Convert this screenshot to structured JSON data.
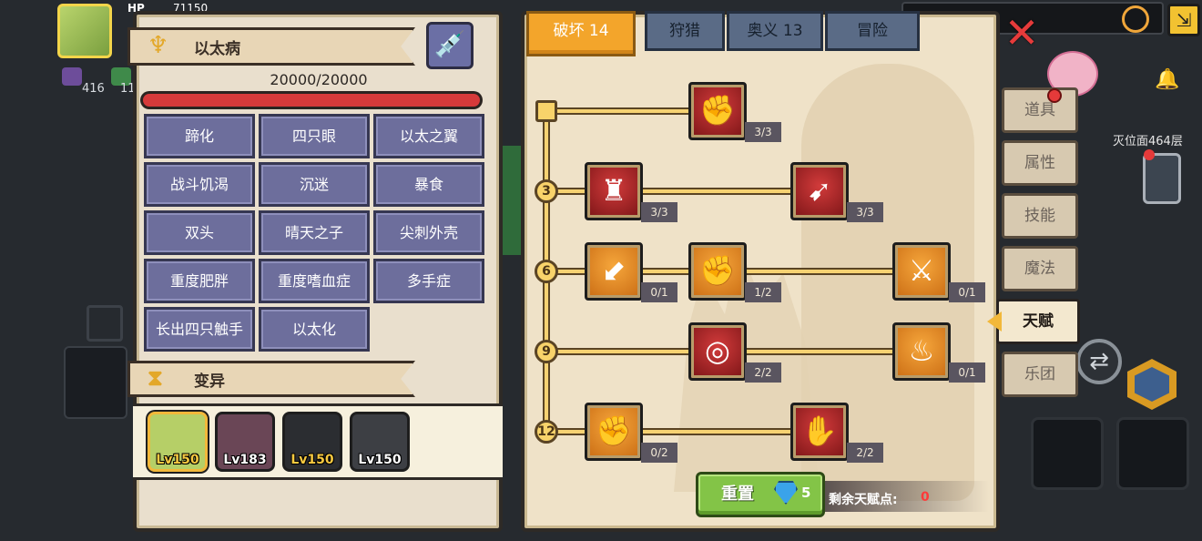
{
  "hud": {
    "hp_label": "HP",
    "hp_value": "71150",
    "stat_a": "416",
    "stat_b": "11",
    "floor_text": "灭位面464层"
  },
  "disease_panel": {
    "title": "以太病",
    "hp_text": "20000/20000",
    "hp_fraction": 1.0,
    "diseases": [
      "蹄化",
      "四只眼",
      "以太之翼",
      "战斗饥渴",
      "沉迷",
      "暴食",
      "双头",
      "晴天之子",
      "尖刺外壳",
      "重度肥胖",
      "重度嗜血症",
      "多手症",
      "长出四只触手",
      "以太化"
    ],
    "mutation_title": "变异",
    "pets": [
      {
        "level": "Lv150",
        "selected": true,
        "gold": true
      },
      {
        "level": "Lv183",
        "selected": false,
        "gold": false
      },
      {
        "level": "Lv150",
        "selected": false,
        "gold": true
      },
      {
        "level": "Lv150",
        "selected": false,
        "gold": false
      }
    ]
  },
  "talent_panel": {
    "tabs": [
      "破坏 14",
      "狩猎",
      "奥义 13",
      "冒险"
    ],
    "active_tab": 0,
    "levels": [
      "3",
      "6",
      "9",
      "12"
    ],
    "talents": {
      "t1": {
        "count": "3/3",
        "icon": "arm-wrestle-icon"
      },
      "t2": {
        "count": "3/3",
        "icon": "muscle-body-icon"
      },
      "t3": {
        "count": "3/3",
        "icon": "arrow-strike-icon"
      },
      "t4": {
        "count": "0/1",
        "icon": "card-arrow-icon"
      },
      "t5": {
        "count": "1/2",
        "icon": "fist-punch-icon"
      },
      "t6": {
        "count": "0/1",
        "icon": "blade-splash-icon"
      },
      "t7": {
        "count": "2/2",
        "icon": "target-ring-icon"
      },
      "t8": {
        "count": "0/1",
        "icon": "flame-drop-icon"
      },
      "t9": {
        "count": "0/2",
        "icon": "raised-fist-icon"
      },
      "t10": {
        "count": "2/2",
        "icon": "hand-wave-icon"
      }
    },
    "reset_label": "重置",
    "gem_count": "5",
    "remaining_label": "剩余天赋点:",
    "remaining_value": "0"
  },
  "side_menu": {
    "items": [
      "道具",
      "属性",
      "技能",
      "魔法",
      "天赋",
      "乐团"
    ],
    "active_index": 4
  }
}
